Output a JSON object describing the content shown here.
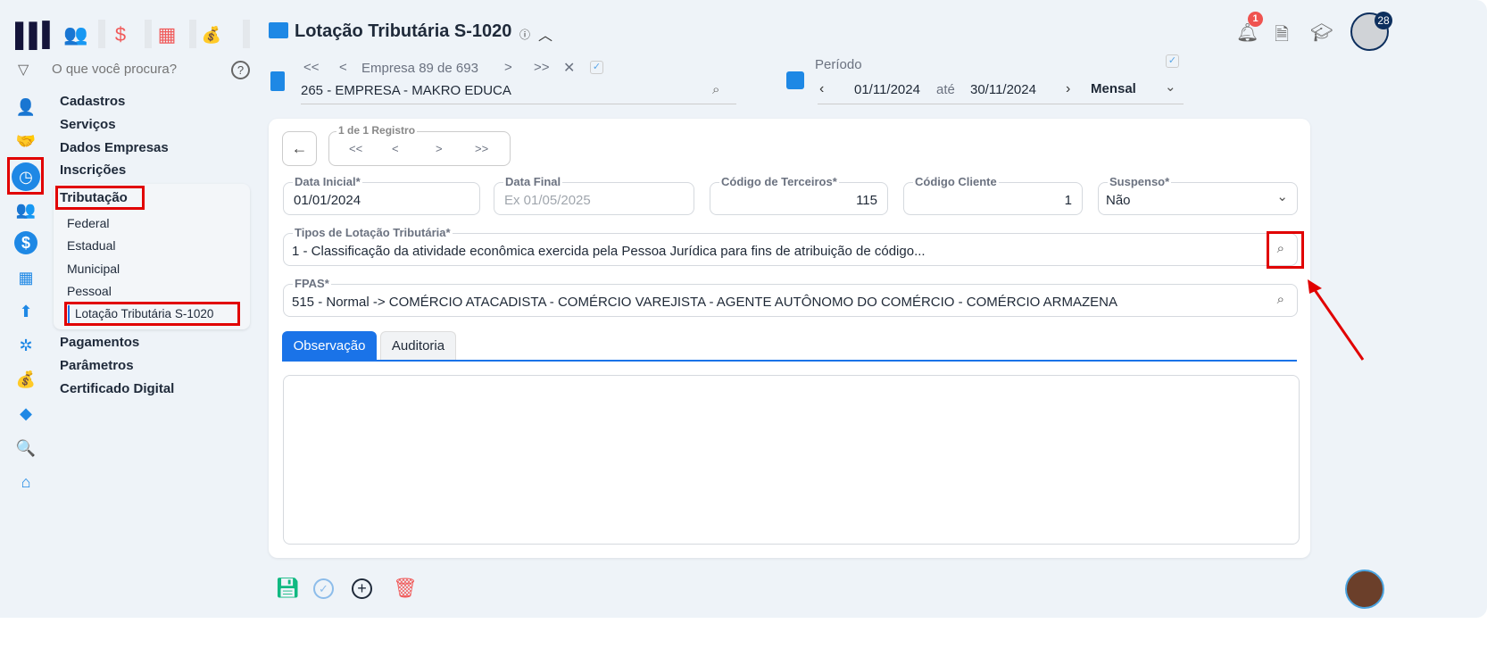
{
  "header": {
    "title": "Lotação Tributária S-1020",
    "notification_count": "1",
    "avatar_badge": "28"
  },
  "search": {
    "placeholder": "O que você procura?"
  },
  "company": {
    "nav_text": "Empresa 89 de 693",
    "first": "<<",
    "prev": "<",
    "next": ">",
    "last": ">>",
    "value": "265 - EMPRESA - MAKRO EDUCA"
  },
  "period": {
    "label": "Período",
    "start": "01/11/2024",
    "sep": "até",
    "end": "30/11/2024",
    "type": "Mensal"
  },
  "menu": {
    "items": [
      "Cadastros",
      "Serviços",
      "Dados Empresas",
      "Inscrições",
      "Tributação",
      "Pagamentos",
      "Parâmetros",
      "Certificado Digital"
    ],
    "sub": [
      "Federal",
      "Estadual",
      "Municipal",
      "Pessoal",
      "Lotação Tributária S-1020"
    ]
  },
  "record": {
    "label": "1 de 1 Registro",
    "first": "<<",
    "prev": "<",
    "next": ">",
    "last": ">>"
  },
  "form": {
    "data_inicial": {
      "label": "Data Inicial*",
      "value": "01/01/2024"
    },
    "data_final": {
      "label": "Data Final",
      "placeholder": "Ex 01/05/2025"
    },
    "cod_terceiros": {
      "label": "Código de Terceiros*",
      "value": "115"
    },
    "cod_cliente": {
      "label": "Código Cliente",
      "value": "1"
    },
    "suspenso": {
      "label": "Suspenso*",
      "value": "Não"
    },
    "tipos": {
      "label": "Tipos de Lotação Tributária*",
      "value": "1 - Classificação da atividade econômica exercida pela Pessoa Jurídica para fins de atribuição de código..."
    },
    "fpas": {
      "label": "FPAS*",
      "value": "515 - Normal -> COMÉRCIO ATACADISTA - COMÉRCIO VAREJISTA - AGENTE AUTÔNOMO DO COMÉRCIO - COMÉRCIO ARMAZENA"
    }
  },
  "tabs": [
    "Observação",
    "Auditoria"
  ],
  "colors": {
    "accent": "#1a73e8",
    "annotation": "#e10000"
  }
}
